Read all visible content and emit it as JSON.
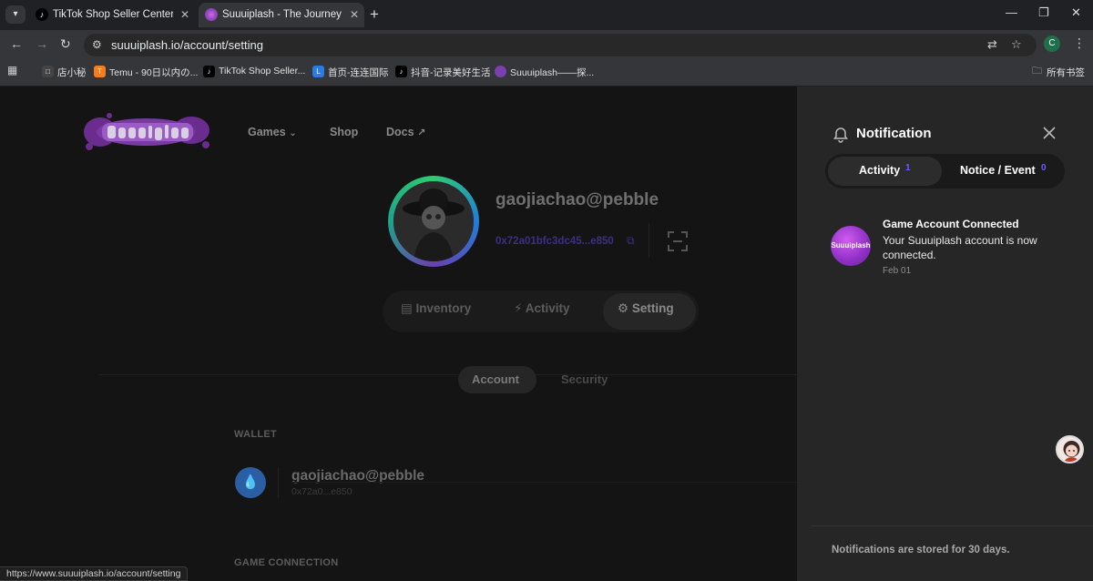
{
  "browser": {
    "tabs": [
      {
        "title": "TikTok Shop Seller Center | C",
        "icon": "tiktok-icon"
      },
      {
        "title": "Suuuiplash - The Journey for",
        "icon": "suuuiplash-icon"
      }
    ],
    "url": "suuuiplash.io/account/setting",
    "profile_initial": "C",
    "bookmarks": [
      {
        "label": "店小秘",
        "icon": "dianxiaomi-icon"
      },
      {
        "label": "Temu - 90日以内の...",
        "icon": "temu-icon"
      },
      {
        "label": "TikTok Shop Seller...",
        "icon": "tiktok-icon"
      },
      {
        "label": "首页-连连国际",
        "icon": "lianlian-icon"
      },
      {
        "label": "抖音-记录美好生活",
        "icon": "douyin-icon"
      },
      {
        "label": "Suuuiplash——探...",
        "icon": "suuuiplash-icon"
      }
    ],
    "all_bookmarks_label": "所有书签",
    "status_url": "https://www.suuuiplash.io/account/setting"
  },
  "site": {
    "nav": {
      "games": "Games",
      "shop": "Shop",
      "docs": "Docs"
    },
    "profile": {
      "username": "gaojiachao@pebble",
      "address": "0x72a01bfc3dc45...e850"
    },
    "profile_tabs": {
      "inventory": "Inventory",
      "activity": "Activity",
      "setting": "Setting",
      "active": "Setting"
    },
    "settings_tabs": {
      "account": "Account",
      "security": "Security",
      "active": "Account"
    },
    "wallet": {
      "section_label": "WALLET",
      "name": "gaojiachao@pebble",
      "address": "0x72a0...e850"
    },
    "game_connection_label": "GAME CONNECTION"
  },
  "notifications": {
    "title": "Notification",
    "tabs": [
      {
        "label": "Activity",
        "count": "1",
        "active": true
      },
      {
        "label": "Notice / Event",
        "count": "0",
        "active": false
      }
    ],
    "items": [
      {
        "title": "Game Account Connected",
        "body": "Your Suuuiplash account is now connected.",
        "date": "Feb 01",
        "icon_text": "Suuuiplash"
      }
    ],
    "footer": "Notifications are stored for 30 days."
  },
  "colors": {
    "accent": "#6b5cff",
    "panel_bg": "#262626",
    "page_bg": "#141414"
  }
}
